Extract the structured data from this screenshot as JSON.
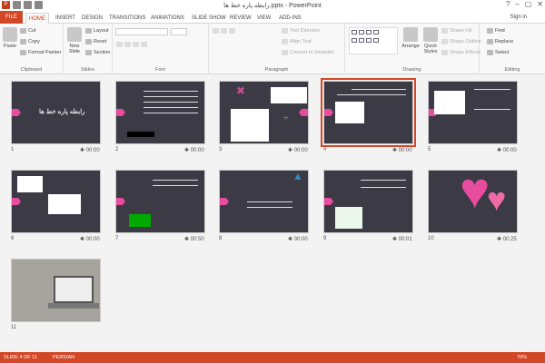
{
  "titlebar": {
    "title": "رابطه پاره خط ها.pptx - PowerPoint",
    "minimize": "–",
    "restore": "▢",
    "close": "✕",
    "help": "?"
  },
  "tabs": [
    "FILE",
    "HOME",
    "INSERT",
    "DESIGN",
    "TRANSITIONS",
    "ANIMATIONS",
    "SLIDE SHOW",
    "REVIEW",
    "VIEW",
    "ADD-INS"
  ],
  "signin": "Sign in",
  "ribbon": {
    "clipboard": {
      "label": "Clipboard",
      "paste": "Paste",
      "cut": "Cut",
      "copy": "Copy",
      "format_painter": "Format Painter"
    },
    "slides": {
      "label": "Slides",
      "new_slide": "New Slide",
      "layout": "Layout",
      "reset": "Reset",
      "section": "Section"
    },
    "font": {
      "label": "Font"
    },
    "paragraph": {
      "label": "Paragraph",
      "text_direction": "Text Direction",
      "align_text": "Align Text",
      "convert_smartart": "Convert to SmartArt"
    },
    "drawing": {
      "label": "Drawing",
      "arrange": "Arrange",
      "quick_styles": "Quick Styles",
      "shape_fill": "Shape Fill",
      "shape_outline": "Shape Outline",
      "shape_effects": "Shape Effects"
    },
    "editing": {
      "label": "Editing",
      "find": "Find",
      "replace": "Replace",
      "select": "Select"
    }
  },
  "slides": [
    {
      "num": "1",
      "dur": "00:00",
      "title": "رابطه پاره خط ها"
    },
    {
      "num": "2",
      "dur": "00:00"
    },
    {
      "num": "3",
      "dur": "00:00"
    },
    {
      "num": "4",
      "dur": "00:00"
    },
    {
      "num": "5",
      "dur": "00:00"
    },
    {
      "num": "6",
      "dur": "00:00"
    },
    {
      "num": "7",
      "dur": "00:50"
    },
    {
      "num": "8",
      "dur": "00:00"
    },
    {
      "num": "9",
      "dur": "00:01"
    },
    {
      "num": "10",
      "dur": "00:25"
    },
    {
      "num": "11",
      "dur": ""
    }
  ],
  "status": {
    "slide": "SLIDE 4 OF 11",
    "lang": "PERSIAN",
    "zoom": "70%"
  },
  "colors": {
    "accent": "#d24726",
    "slide_bg": "#3b3a45",
    "pink": "#e74c9e"
  }
}
